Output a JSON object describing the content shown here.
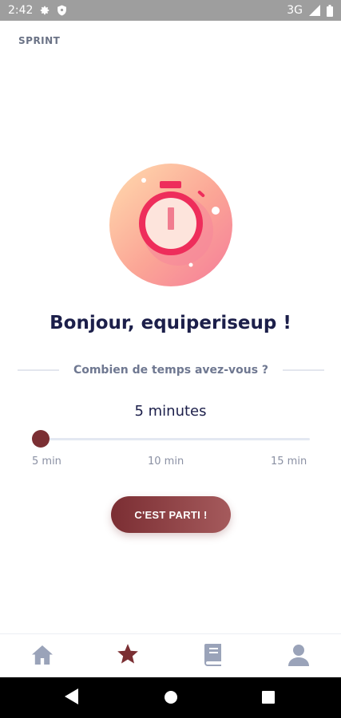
{
  "status_bar": {
    "time": "2:42",
    "network": "3G",
    "icons": [
      "settings-icon",
      "shield-icon",
      "signal-icon",
      "battery-icon"
    ]
  },
  "page": {
    "section_label": "SPRINT",
    "greeting": "Bonjour, equiperiseup !",
    "question": "Combien de temps avez-vous ?"
  },
  "duration": {
    "value_text": "5 minutes",
    "value_fraction": 0.0,
    "min_label": "5 min",
    "mid_label": "10 min",
    "max_label": "15 min"
  },
  "start_button": {
    "label": "C'EST PARTI !"
  },
  "bottom_nav": {
    "items": [
      {
        "icon": "home-icon",
        "active": false
      },
      {
        "icon": "star-icon",
        "active": true
      },
      {
        "icon": "book-icon",
        "active": false
      },
      {
        "icon": "user-icon",
        "active": false
      }
    ]
  },
  "system_nav": {
    "buttons": [
      "back-icon",
      "home-circle-icon",
      "recents-icon"
    ]
  },
  "colors": {
    "accent": "#7b2f33",
    "title": "#1c1f4a",
    "muted": "#6f7891",
    "nav_inactive": "#9aa3b9",
    "stopwatch_red": "#ee2d5b",
    "badge_gradient_start": "#ffd8b0",
    "badge_gradient_end": "#f57b99"
  }
}
